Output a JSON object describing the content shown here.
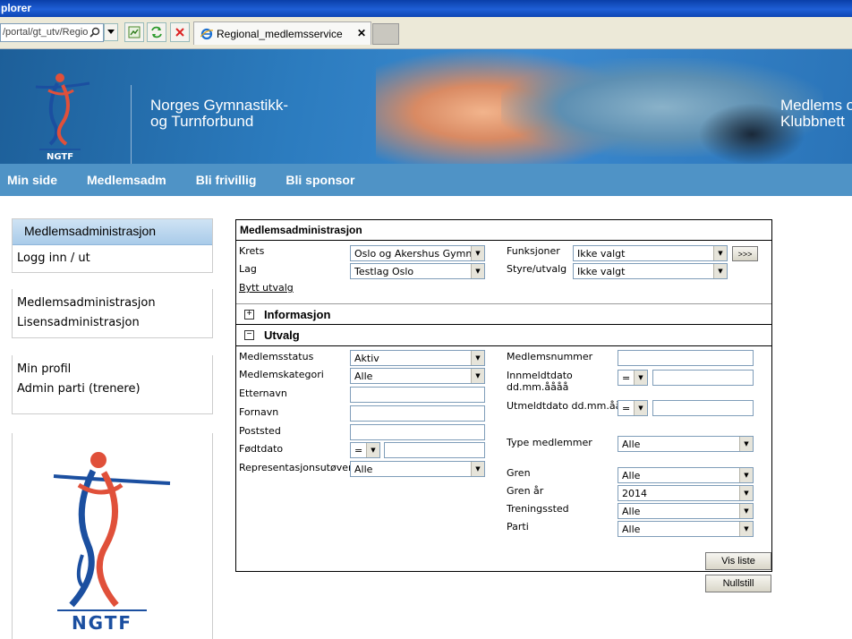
{
  "window": {
    "title": "plorer"
  },
  "toolbar": {
    "address": "/portal/gt_utv/Regio",
    "tab_title": "Regional_medlemsservice",
    "tab_close": "✕"
  },
  "banner": {
    "org_line1": "Norges Gymnastikk-",
    "org_line2": "og Turnforbund",
    "right_line1": "Medlems o",
    "right_line2": "Klubbnett",
    "logo_text": "NGTF"
  },
  "nav": {
    "items": [
      "Min side",
      "Medlemsadm",
      "Bli frivillig",
      "Bli sponsor"
    ]
  },
  "sidebar": {
    "header": "Medlemsadministrasjon",
    "login": "Logg inn / ut",
    "group2": [
      "Medlemsadministrasjon",
      "Lisensadministrasjon"
    ],
    "group3": [
      "Min profil",
      "Admin parti (trenere)"
    ],
    "logo_text": "NGTF"
  },
  "panel": {
    "title": "Medlemsadministrasjon",
    "krets_label": "Krets",
    "krets_value": "Oslo og Akershus Gymn- og",
    "lag_label": "Lag",
    "lag_value": "Testlag Oslo",
    "bytt_utvalg": "Bytt utvalg",
    "funksjoner_label": "Funksjoner",
    "funksjoner_value": "Ikke valgt",
    "styre_label": "Styre/utvalg",
    "styre_value": "Ikke valgt",
    "more_button": ">>>",
    "section_info": "Informasjon",
    "section_utvalg": "Utvalg",
    "expand_symbol": "+",
    "collapse_symbol": "−",
    "medlemsstatus_label": "Medlemsstatus",
    "medlemsstatus_value": "Aktiv",
    "medlemskategori_label": "Medlemskategori",
    "medlemskategori_value": "Alle",
    "etternavn_label": "Etternavn",
    "etternavn_value": "",
    "fornavn_label": "Fornavn",
    "fornavn_value": "",
    "poststed_label": "Poststed",
    "poststed_value": "",
    "fodtdato_label": "Fødtdato",
    "fodtdato_op": "=",
    "fodtdato_value": "",
    "representasjon_label": "Representasjonsutøver",
    "representasjon_value": "Alle",
    "medlemsnummer_label": "Medlemsnummer",
    "medlemsnummer_value": "",
    "innmeldt_label_1": "Innmeldtdato",
    "innmeldt_label_2": "dd.mm.åååå",
    "innmeldt_op": "=",
    "innmeldt_value": "",
    "utmeldt_label": "Utmeldtdato dd.mm.åååå",
    "utmeldt_op": "=",
    "utmeldt_value": "",
    "type_label": "Type medlemmer",
    "type_value": "Alle",
    "gren_label": "Gren",
    "gren_value": "Alle",
    "gren_ar_label": "Gren år",
    "gren_ar_value": "2014",
    "treningssted_label": "Treningssted",
    "treningssted_value": "Alle",
    "parti_label": "Parti",
    "parti_value": "Alle"
  },
  "buttons": {
    "vis_liste": "Vis liste",
    "nullstill": "Nullstill"
  },
  "colors": {
    "nav": "#4f93c6",
    "logo_red": "#e0503a",
    "logo_blue": "#1b4fa0"
  }
}
